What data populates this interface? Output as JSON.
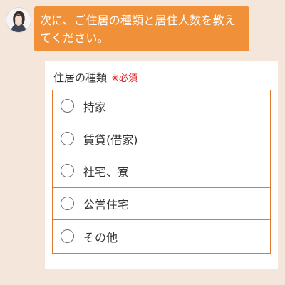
{
  "chat": {
    "avatar_icon": "operator-avatar-icon",
    "message": "次に、ご住居の種類と居住人数を教えてください。"
  },
  "form": {
    "question": "住居の種類",
    "required": "※必須",
    "options": [
      {
        "label": "持家",
        "selected": false
      },
      {
        "label": "賃貸(借家)",
        "selected": false
      },
      {
        "label": "社宅、寮",
        "selected": false
      },
      {
        "label": "公営住宅",
        "selected": false
      },
      {
        "label": "その他",
        "selected": false
      }
    ]
  },
  "colors": {
    "background": "#f5e6dc",
    "bubble": "#f0913a",
    "option_border": "#e07a2a",
    "required_text": "#e02020"
  }
}
